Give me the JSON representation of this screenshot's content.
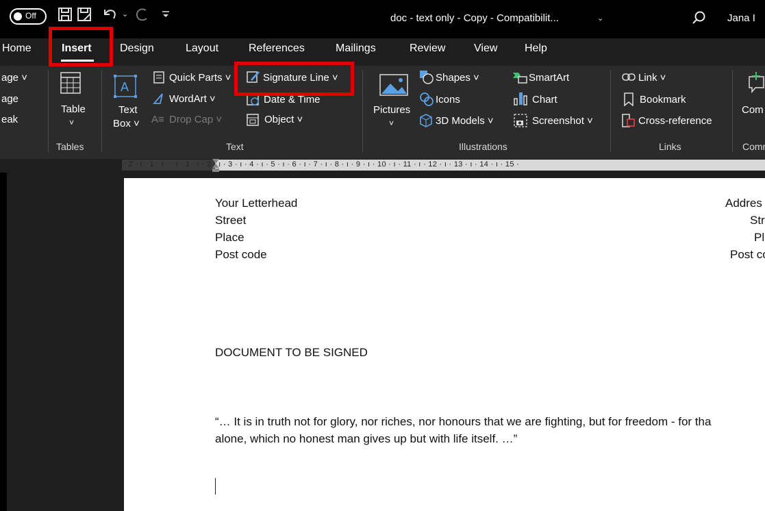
{
  "titlebar": {
    "autosave_label": "Off",
    "doc_title": "doc - text only - Copy  -  Compatibilit...",
    "title_caret": "⌄",
    "user_name": "Jana I"
  },
  "tabs": [
    {
      "label": "Home"
    },
    {
      "label": "Insert"
    },
    {
      "label": "Design"
    },
    {
      "label": "Layout"
    },
    {
      "label": "References"
    },
    {
      "label": "Mailings"
    },
    {
      "label": "Review"
    },
    {
      "label": "View"
    },
    {
      "label": "Help"
    }
  ],
  "ribbon": {
    "pages": {
      "cover_page": "age ˅",
      "blank_page": "age",
      "page_break": "eak"
    },
    "tables": {
      "table_button": "Table",
      "table_caret": "˅",
      "group_label": "Tables"
    },
    "text": {
      "text_box_line1": "Text",
      "text_box_line2": "Box ˅",
      "quick_parts": "Quick Parts ˅",
      "wordart": "WordArt ˅",
      "drop_cap": "Drop Cap ˅",
      "signature_line": "Signature Line  ˅",
      "date_time": "Date & Time",
      "object": "Object  ˅",
      "group_label": "Text"
    },
    "illustrations": {
      "pictures": "Pictures",
      "pictures_caret": "˅",
      "shapes": "Shapes ˅",
      "icons": "Icons",
      "models3d": "3D Models  ˅",
      "smartart": "SmartArt",
      "chart": "Chart",
      "screenshot": "Screenshot ˅",
      "group_label": "Illustrations"
    },
    "links": {
      "link": "Link  ˅",
      "bookmark": "Bookmark",
      "cross_reference": "Cross-reference",
      "group_label": "Links"
    },
    "comments": {
      "comment": "Com",
      "group_label": "Comr"
    }
  },
  "ruler": {
    "text": "· 2 · ı · 1 · ı ·   · ı · 1 · ı · 2 · ı · 3 · ı · 4 · ı · 5 · ı · 6 · ı · 7 · ı · 8 · ı · 9 · ı · 10 · ı · 11 · ı · 12 · ı · 13 · ı · 14 · ı · 15 ·"
  },
  "document": {
    "letterhead": [
      "Your Letterhead",
      "Street",
      "Place",
      "Post code"
    ],
    "address": [
      "Addres",
      "Str",
      "Pl",
      "Post co"
    ],
    "heading": "DOCUMENT TO BE SIGNED",
    "quote_line1": "“… It is in truth not for glory, nor riches, nor honours that we are fighting, but for freedom - for tha",
    "quote_line2": "alone, which no honest man gives up but with life itself. …”"
  },
  "highlight_color": "#e00000"
}
